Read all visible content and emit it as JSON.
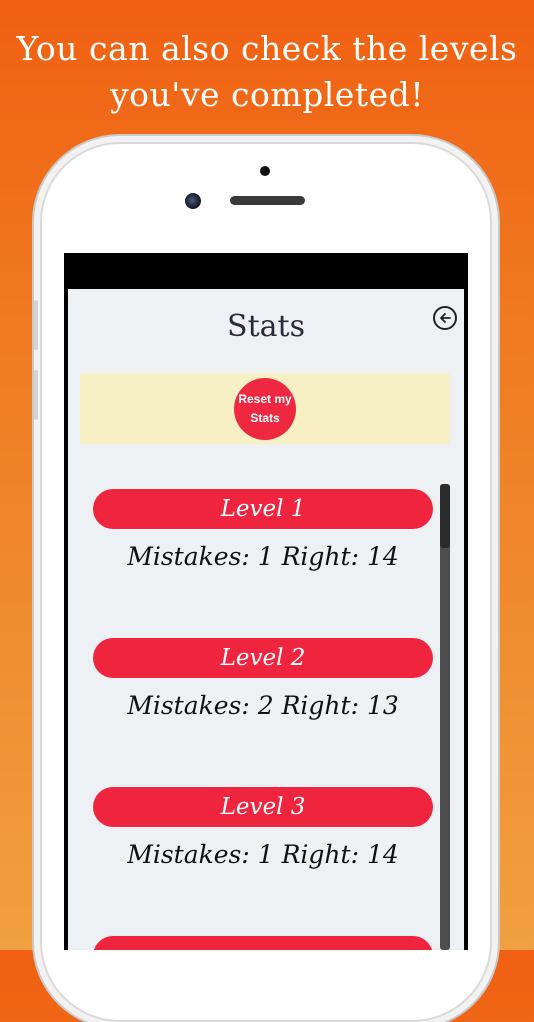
{
  "caption": {
    "line1": "You can also check the levels",
    "line2": "you've completed!"
  },
  "screen": {
    "title": "Stats",
    "back_icon": "arrow-left-circle-icon",
    "reset_button": {
      "line1": "Reset my",
      "line2": "Stats"
    },
    "levels": [
      {
        "label": "Level 1",
        "stats": "Mistakes: 1 Right: 14"
      },
      {
        "label": "Level 2",
        "stats": "Mistakes: 2 Right: 13"
      },
      {
        "label": "Level 3",
        "stats": "Mistakes: 1 Right: 14"
      }
    ]
  },
  "colors": {
    "accent": "#ef2540",
    "reset_bar": "#f7f0c4",
    "app_background": "#edf1f3"
  }
}
